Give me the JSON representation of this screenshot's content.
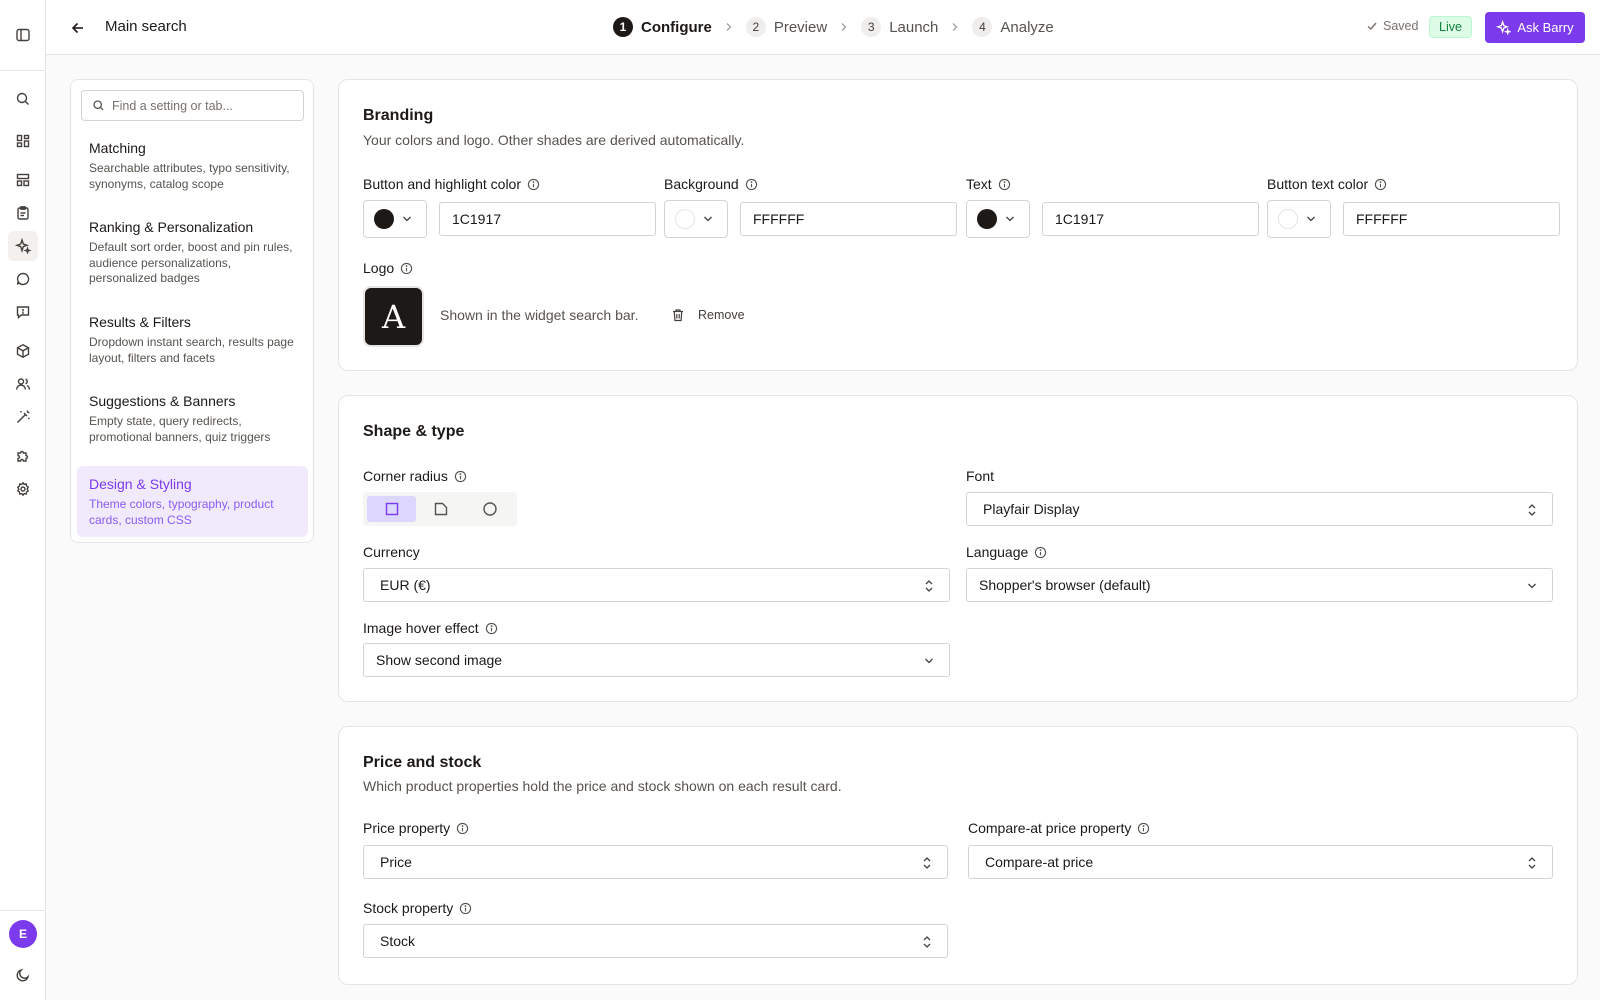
{
  "topbar": {
    "title": "Main search",
    "steps": [
      {
        "num": "1",
        "label": "Configure"
      },
      {
        "num": "2",
        "label": "Preview"
      },
      {
        "num": "3",
        "label": "Launch"
      },
      {
        "num": "4",
        "label": "Analyze"
      }
    ],
    "saved": "Saved",
    "live": "Live",
    "ask": "Ask Barry"
  },
  "rail": {
    "avatar": "E",
    "icons": [
      "sidebar-toggle-icon",
      "search-icon",
      "grid-icon",
      "layout-icon",
      "clipboard-icon",
      "sparkles-icon",
      "chat-icon",
      "message-square-icon",
      "box-icon",
      "users-icon",
      "magic-wand-icon",
      "puzzle-icon",
      "gear-icon",
      "moon-icon"
    ]
  },
  "nav": {
    "search_placeholder": "Find a setting or tab...",
    "items": [
      {
        "title": "Matching",
        "desc": "Searchable attributes, typo sensitivity, synonyms, catalog scope"
      },
      {
        "title": "Ranking & Personalization",
        "desc": "Default sort order, boost and pin rules, audience personalizations, personalized badges"
      },
      {
        "title": "Results & Filters",
        "desc": "Dropdown instant search, results page layout, filters and facets"
      },
      {
        "title": "Suggestions & Banners",
        "desc": "Empty state, query redirects, promotional banners, quiz triggers"
      },
      {
        "title": "Design & Styling",
        "desc": "Theme colors, typography, product cards, custom CSS"
      }
    ]
  },
  "branding": {
    "title": "Branding",
    "subtitle": "Your colors and logo. Other shades are derived automatically.",
    "colors": [
      {
        "label": "Button and highlight color",
        "value": "1C1917",
        "swatch": "#1c1917"
      },
      {
        "label": "Background",
        "value": "FFFFFF",
        "swatch": "#ffffff"
      },
      {
        "label": "Text",
        "value": "1C1917",
        "swatch": "#1c1917"
      },
      {
        "label": "Button text color",
        "value": "FFFFFF",
        "swatch": "#ffffff"
      }
    ],
    "logo_label": "Logo",
    "logo_letter": "A",
    "logo_hint": "Shown in the widget search bar.",
    "remove": "Remove"
  },
  "shape": {
    "title": "Shape & type",
    "corner_radius": "Corner radius",
    "font_label": "Font",
    "font_value": "Playfair Display",
    "currency_label": "Currency",
    "currency_value": "EUR (€)",
    "language_label": "Language",
    "language_value": "Shopper's browser (default)",
    "hover_label": "Image hover effect",
    "hover_value": "Show second image"
  },
  "price": {
    "title": "Price and stock",
    "subtitle": "Which product properties hold the price and stock shown on each result card.",
    "price_label": "Price property",
    "price_value": "Price",
    "compare_label": "Compare-at price property",
    "compare_value": "Compare-at price",
    "stock_label": "Stock property",
    "stock_value": "Stock"
  },
  "colors": {
    "accent": "#7c3aed",
    "live_bg": "#dcfce7",
    "text": "#1c1917"
  }
}
